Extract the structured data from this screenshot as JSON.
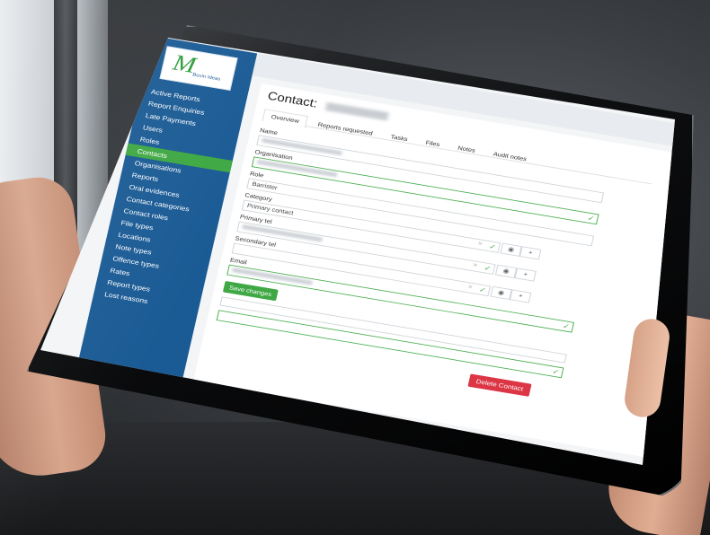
{
  "sidebar": {
    "logo_letter": "M",
    "logo_text": "Bevin Ideas",
    "items": [
      {
        "label": "Active Reports"
      },
      {
        "label": "Report Enquiries"
      },
      {
        "label": "Late Payments"
      },
      {
        "label": "Users"
      },
      {
        "label": "Roles"
      },
      {
        "label": "Contacts"
      },
      {
        "label": "Organisations"
      },
      {
        "label": "Reports"
      },
      {
        "label": "Oral evidences"
      },
      {
        "label": "Contact categories"
      },
      {
        "label": "Contact roles"
      },
      {
        "label": "File types"
      },
      {
        "label": "Locations"
      },
      {
        "label": "Note types"
      },
      {
        "label": "Offence types"
      },
      {
        "label": "Rates"
      },
      {
        "label": "Report types"
      },
      {
        "label": "Lost reasons"
      }
    ],
    "active_index": 5
  },
  "content": {
    "title": "Contact:",
    "tabs": [
      "Overview",
      "Reports requested",
      "Tasks",
      "Files",
      "Notes",
      "Audit notes"
    ],
    "fields": {
      "name_label": "Name",
      "organisation_label": "Organisation",
      "role_label": "Role",
      "role_value": "Barrister",
      "category_label": "Category",
      "category_value": "Primary contact",
      "primary_tel_label": "Primary tel",
      "secondary_tel_label": "Secondary tel",
      "email_label": "Email"
    },
    "save_label": "Save changes",
    "delete_label": "Delete Contact"
  },
  "colors": {
    "sidebar": "#1b5b95",
    "active": "#3fa844",
    "delete": "#dc3545"
  }
}
